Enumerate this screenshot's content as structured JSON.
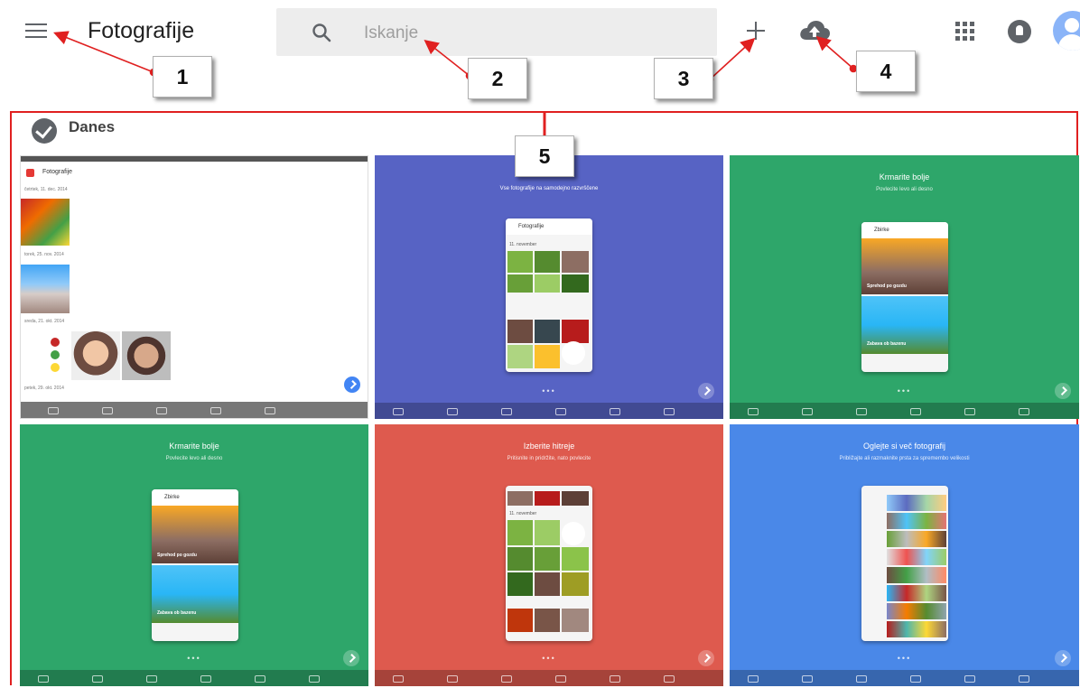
{
  "app": {
    "title": "Fotografije",
    "search_placeholder": "Iskanje"
  },
  "icons": {
    "menu": "menu-icon",
    "search": "search-icon",
    "create": "plus-icon",
    "upload": "cloud-upload-icon",
    "apps": "apps-grid-icon",
    "notifications": "notifications-icon",
    "account": "avatar"
  },
  "callouts": [
    "1",
    "2",
    "3",
    "4",
    "5"
  ],
  "section": {
    "date_label": "Danes"
  },
  "tiles": [
    {
      "bg": "#ffffff",
      "app_header": "Fotografije",
      "dates": [
        "četrtek, 11. dec. 2014",
        "torek, 25. nov. 2014",
        "sreda, 21. okt. 2014",
        "petek, 29. okt. 2014"
      ]
    },
    {
      "bg": "#5763c4",
      "title": "Vse fotografije na samodejno razvrščene",
      "phone_header": "Fotografije",
      "phone_date": "11. november"
    },
    {
      "bg": "#2ea66a",
      "title": "Krmarite bolje",
      "subtitle": "Povlecite levo ali desno",
      "phone_header": "Zbirke",
      "label_a": "Sprehod po gozdu",
      "label_b": "Zabava ob bazenu"
    },
    {
      "bg": "#2ea66a",
      "title": "Krmarite bolje",
      "subtitle": "Povlecite levo ali desno",
      "phone_header": "Zbirke",
      "label_a": "Sprehod po gozdu",
      "label_b": "Zabava ob bazenu"
    },
    {
      "bg": "#de5a4e",
      "title": "Izberite hitreje",
      "subtitle": "Pritisnite in pridržite, nato povlecite",
      "phone_date": "11. november"
    },
    {
      "bg": "#4a88e8",
      "title": "Oglejte si več fotografij",
      "subtitle": "Približajte ali razmaknite prsta za spremembo velikosti"
    }
  ],
  "colors": {
    "accent_red": "#e02020",
    "icon_gray": "#5f6368",
    "search_bg": "#ededed"
  }
}
